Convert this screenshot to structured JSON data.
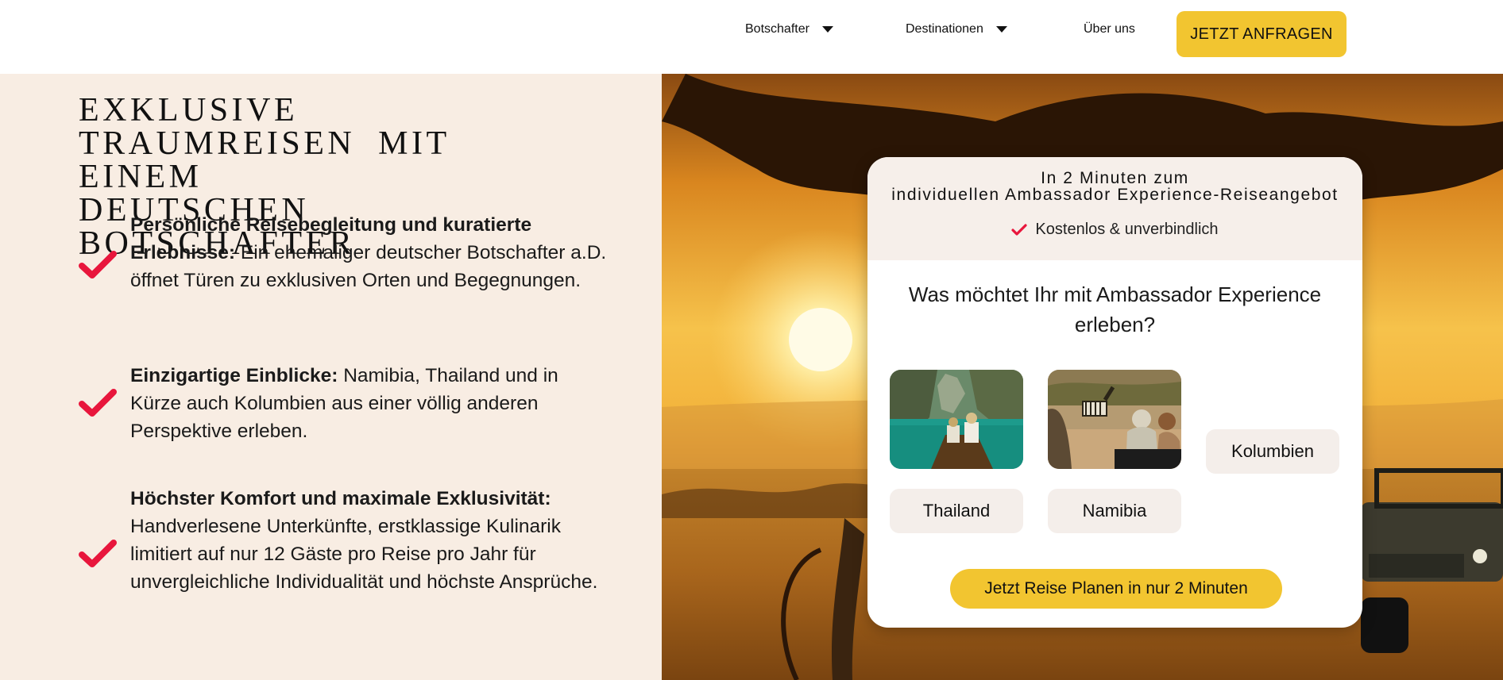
{
  "nav": {
    "items": [
      {
        "label": "Botschafter"
      },
      {
        "label": "Destinationen"
      },
      {
        "label": "Über uns"
      }
    ],
    "cta_label": "JETZT ANFRAGEN"
  },
  "hero": {
    "heading_lines": [
      "EXKLUSIVE",
      "TRAUMREISEN MIT EINEM",
      "DEUTSCHEN BOTSCHAFTER"
    ],
    "features": [
      {
        "bold": "Persönliche Reisebegleitung und kuratierte Erlebnisse:",
        "text": " Ein ehemaliger deutscher Botschafter a.D. öffnet Türen zu exklusiven Orten und Begegnungen."
      },
      {
        "bold": "Einzigartige Einblicke:",
        "text": " Namibia, Thailand und in Kürze auch Kolumbien aus einer völlig anderen Perspektive erleben."
      },
      {
        "bold": "Höchster Komfort und maximale Exklusivität:",
        "text": " Handverlesene Unterkünfte, erstklassige Kulinarik limitiert auf nur 12 Gäste pro Reise pro Jahr für unvergleichliche Individualität und höchste Ansprüche."
      }
    ]
  },
  "quiz": {
    "title_line1": "In 2 Minuten zum",
    "title_line2": "individuellen Ambassador Experience-Reiseangebot",
    "subtitle": "Kostenlos & unverbindlich",
    "question": "Was möchtet Ihr mit Ambassador Experience erleben?",
    "options": [
      {
        "label": "Thailand"
      },
      {
        "label": "Namibia"
      },
      {
        "label": "Kolumbien"
      }
    ],
    "submit_label": "Jetzt Reise Planen in nur 2 Minuten"
  },
  "colors": {
    "accent": "#f2c530",
    "check": "#e8163c",
    "panel": "#f8ede3"
  }
}
